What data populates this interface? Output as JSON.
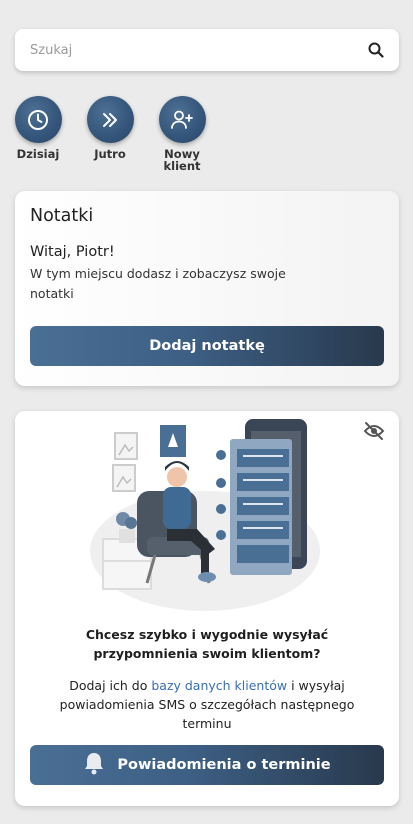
{
  "search": {
    "placeholder": "Szukaj",
    "icon": "search-icon"
  },
  "quick_actions": [
    {
      "label": "Dzisiaj",
      "icon": "clock-icon"
    },
    {
      "label": "Jutro",
      "icon": "double-chevron-right-icon"
    },
    {
      "label": "Nowy\nklient",
      "icon": "add-user-icon"
    }
  ],
  "notes": {
    "title": "Notatki",
    "greeting": "Witaj, Piotr!",
    "description": "W tym miejscu dodasz i zobaczysz swoje notatki",
    "button_label": "Dodaj notatkę"
  },
  "promo": {
    "hide_icon": "eye-off-icon",
    "question": "Chcesz szybko i wygodnie wysyłać przypomnienia swoim klientom?",
    "text_before_link": "Dodaj ich do ",
    "link_text": "bazy danych klientów",
    "text_after_link": " i wysyłaj powiadomienia SMS o szczegółach następnego terminu",
    "button_label": "Powiadomienia o terminie",
    "button_icon": "bell-icon"
  },
  "colors": {
    "background": "#ebebeb",
    "primary": "#3d5f84",
    "primary_dark": "#28394d",
    "link": "#3a6fb0"
  }
}
